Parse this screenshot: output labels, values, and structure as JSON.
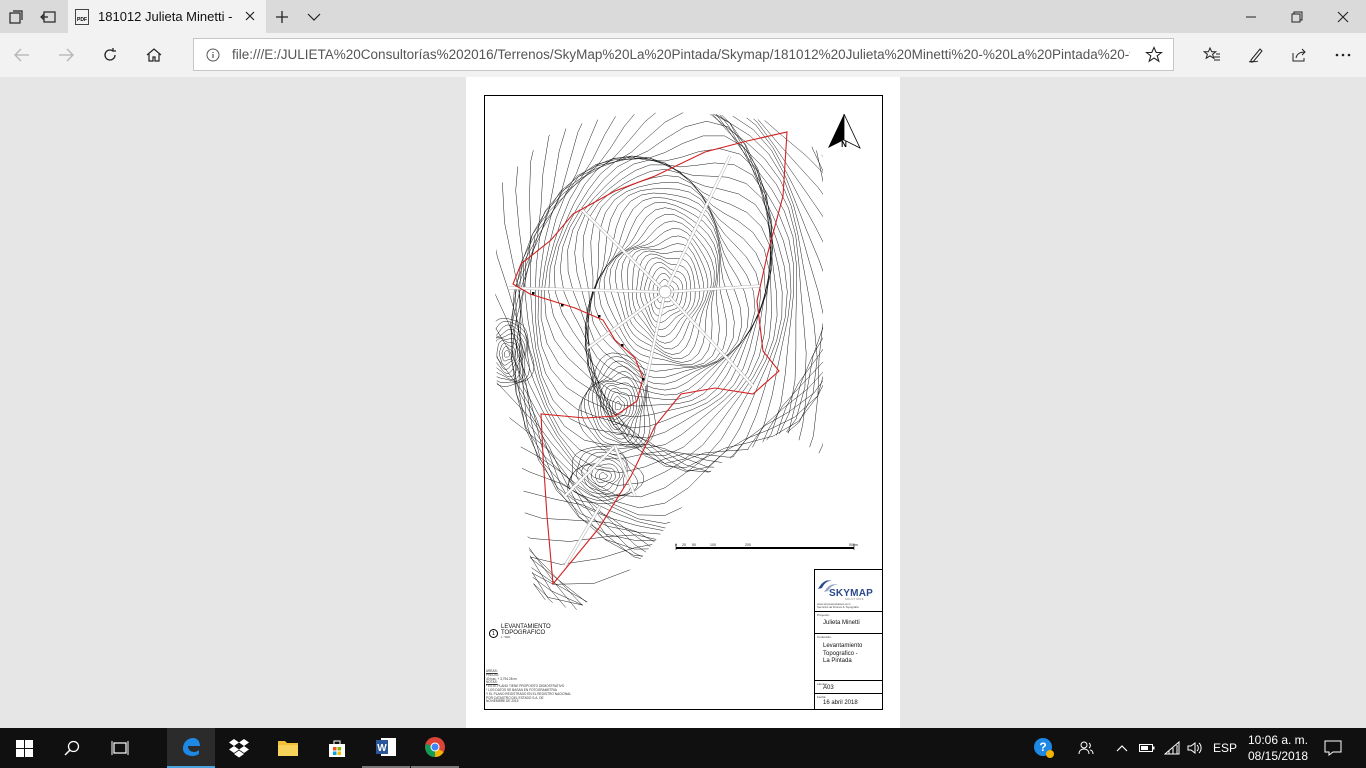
{
  "browser": {
    "tab_title": "181012 Julieta Minetti -",
    "address": "file:///E:/JULIETA%20Consultorías%202016/Terrenos/SkyMap%20La%20Pintada/Skymap/181012%20Julieta%20Minetti%20-%20La%20Pintada%20-%20A03.pc"
  },
  "document": {
    "north_label": "N",
    "scale_ticks": [
      "0",
      "20",
      "50",
      "100",
      "200",
      "500m"
    ],
    "plot_title": "LEVANTAMIENTO",
    "plot_subtitle": "TOPOGRAFICO",
    "plot_number": "1",
    "plot_scale": "1 : 5000",
    "notes": [
      "AREAS:",
      "PREDIO:",
      "40 has. + 3,794.28 m²",
      "NOTAS:",
      "* ESTE PLANO TIENE PROPOSITO DEMOSTRATIVO",
      "* LOS DATOS SE BASAN EN FOTOGRAMETRIA",
      "  Y EL PLANO REGISTRADO EN EL REGISTRO NACIONAL",
      "  POR CATASTRO DEL ESTADO S.A. DE",
      "  NOVIEMBRE DE 2015"
    ],
    "title_block": {
      "logo": "SKYMAP",
      "logo_tagline": "SOLUTIONS",
      "logo_contact": [
        "www.skymapsolutions.com",
        "Servicios de Drones & Topografía"
      ],
      "client_caption": "Proyecto:",
      "client": "Julieta Minetti",
      "content_caption": "Contenido:",
      "content": [
        "Levantamiento",
        "Topografico -",
        "La Pintada"
      ],
      "sheet_caption": "Lámina:",
      "sheet": "A03",
      "date_caption": "Fecha:",
      "date": "16 abril 2018"
    }
  },
  "taskbar": {
    "language": "ESP",
    "time": "10:06 a. m.",
    "date": "08/15/2018"
  }
}
